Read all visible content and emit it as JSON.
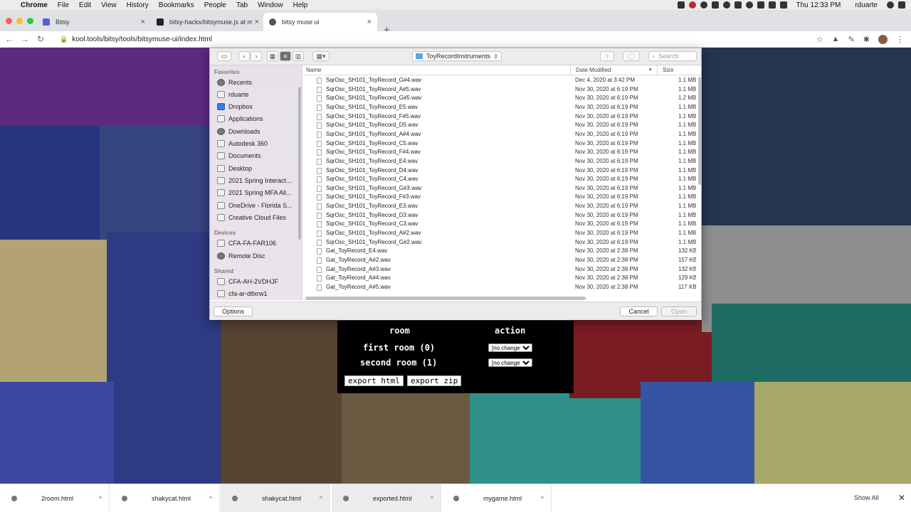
{
  "menubar": {
    "apple": "",
    "items": [
      "Chrome",
      "File",
      "Edit",
      "View",
      "History",
      "Bookmarks",
      "People",
      "Tab",
      "Window",
      "Help"
    ],
    "clock": "Thu 12:33 PM",
    "user": "rduarte"
  },
  "tabs": [
    {
      "title": "Bitsy",
      "favicon_color": "#5b5bd6"
    },
    {
      "title": "bitsy-hacks/bitsymuse.js at ma",
      "favicon_color": "#222222"
    },
    {
      "title": "bitsy muse ui",
      "favicon_color": "#555555"
    }
  ],
  "newtab": "+",
  "toolbar": {
    "back": "←",
    "forward": "→",
    "reload": "↻",
    "url": "kool.tools/bitsy/tools/bitsymuse-ui/index.html",
    "star": "☆"
  },
  "dialog": {
    "location": "ToyRecordInstruments",
    "search_placeholder": "Search",
    "columns": {
      "name": "Name",
      "date": "Date Modified",
      "size": "Size"
    },
    "sidebar": {
      "favorites_label": "Favorites",
      "favorites": [
        "Recents",
        "rduarte",
        "Dropbox",
        "Applications",
        "Downloads",
        "Autodesk 360",
        "Documents",
        "Desktop",
        "2021 Spring Interact...",
        "2021 Spring MFA All...",
        "OneDrive - Florida S...",
        "Creative Cloud Files"
      ],
      "devices_label": "Devices",
      "devices": [
        "CFA-FA-FAR106",
        "Remote Disc"
      ],
      "shared_label": "Shared",
      "shared": [
        "CFA-AH-2VDHJF",
        "cfa-ar-dtlxrw1"
      ]
    },
    "files": [
      {
        "name": "SqrOsc_SH101_ToyRecord_G#4.wav",
        "date": "Dec 4, 2020 at 3:42 PM",
        "size": "1.1 MB"
      },
      {
        "name": "SqrOsc_SH101_ToyRecord_A#5.wav",
        "date": "Nov 30, 2020 at 6:19 PM",
        "size": "1.1 MB"
      },
      {
        "name": "SqrOsc_SH101_ToyRecord_G#5.wav",
        "date": "Nov 30, 2020 at 6:19 PM",
        "size": "1.2 MB"
      },
      {
        "name": "SqrOsc_SH101_ToyRecord_E5.wav",
        "date": "Nov 30, 2020 at 6:19 PM",
        "size": "1.1 MB"
      },
      {
        "name": "SqrOsc_SH101_ToyRecord_F#5.wav",
        "date": "Nov 30, 2020 at 6:19 PM",
        "size": "1.1 MB"
      },
      {
        "name": "SqrOsc_SH101_ToyRecord_D5.wav",
        "date": "Nov 30, 2020 at 6:19 PM",
        "size": "1.1 MB"
      },
      {
        "name": "SqrOsc_SH101_ToyRecord_A#4.wav",
        "date": "Nov 30, 2020 at 6:19 PM",
        "size": "1.1 MB"
      },
      {
        "name": "SqrOsc_SH101_ToyRecord_C5.wav",
        "date": "Nov 30, 2020 at 6:19 PM",
        "size": "1.1 MB"
      },
      {
        "name": "SqrOsc_SH101_ToyRecord_F#4.wav",
        "date": "Nov 30, 2020 at 6:19 PM",
        "size": "1.1 MB"
      },
      {
        "name": "SqrOsc_SH101_ToyRecord_E4.wav",
        "date": "Nov 30, 2020 at 6:19 PM",
        "size": "1.1 MB"
      },
      {
        "name": "SqrOsc_SH101_ToyRecord_D4.wav",
        "date": "Nov 30, 2020 at 6:19 PM",
        "size": "1.1 MB"
      },
      {
        "name": "SqrOsc_SH101_ToyRecord_C4.wav",
        "date": "Nov 30, 2020 at 6:19 PM",
        "size": "1.1 MB"
      },
      {
        "name": "SqrOsc_SH101_ToyRecord_G#3.wav",
        "date": "Nov 30, 2020 at 6:19 PM",
        "size": "1.1 MB"
      },
      {
        "name": "SqrOsc_SH101_ToyRecord_F#3.wav",
        "date": "Nov 30, 2020 at 6:19 PM",
        "size": "1.1 MB"
      },
      {
        "name": "SqrOsc_SH101_ToyRecord_E3.wav",
        "date": "Nov 30, 2020 at 6:19 PM",
        "size": "1.1 MB"
      },
      {
        "name": "SqrOsc_SH101_ToyRecord_D3.wav",
        "date": "Nov 30, 2020 at 6:19 PM",
        "size": "1.1 MB"
      },
      {
        "name": "SqrOsc_SH101_ToyRecord_C3.wav",
        "date": "Nov 30, 2020 at 6:19 PM",
        "size": "1.1 MB"
      },
      {
        "name": "SqrOsc_SH101_ToyRecord_A#2.wav",
        "date": "Nov 30, 2020 at 6:19 PM",
        "size": "1.1 MB"
      },
      {
        "name": "SqrOsc_SH101_ToyRecord_G#2.wav",
        "date": "Nov 30, 2020 at 6:19 PM",
        "size": "1.1 MB"
      },
      {
        "name": "Gat_ToyRecord_E4.wav",
        "date": "Nov 30, 2020 at 2:38 PM",
        "size": "132 KB"
      },
      {
        "name": "Gat_ToyRecord_A#2.wav",
        "date": "Nov 30, 2020 at 2:38 PM",
        "size": "157 KB"
      },
      {
        "name": "Gat_ToyRecord_A#3.wav",
        "date": "Nov 30, 2020 at 2:38 PM",
        "size": "132 KB"
      },
      {
        "name": "Gat_ToyRecord_A#4.wav",
        "date": "Nov 30, 2020 at 2:38 PM",
        "size": "129 KB"
      },
      {
        "name": "Gat_ToyRecord_A#5.wav",
        "date": "Nov 30, 2020 at 2:38 PM",
        "size": "117 KB"
      }
    ],
    "options_label": "Options",
    "cancel_label": "Cancel",
    "open_label": "Open"
  },
  "muse": {
    "room_header": "room",
    "action_header": "action",
    "rooms": [
      {
        "label": "first room (0)",
        "action": "[no change]"
      },
      {
        "label": "second room (1)",
        "action": "[no change]"
      }
    ],
    "export_html": "export html",
    "export_zip": "export zip"
  },
  "downloads": {
    "items": [
      "2room.html",
      "shakycat.html",
      "shakycat.html",
      "exported.html",
      "mygame.html"
    ],
    "show_all": "Show All",
    "close": "✕"
  },
  "colors": {
    "accent": "#3d7de0",
    "muse_bg": "#000000"
  }
}
